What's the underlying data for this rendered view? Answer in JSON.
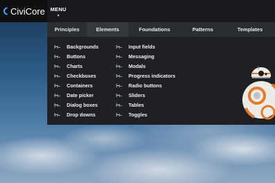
{
  "app": {
    "name": "CiviCore"
  },
  "header": {
    "menu_label": "MENU"
  },
  "tabs": [
    {
      "label": "Principles"
    },
    {
      "label": "Elements"
    },
    {
      "label": "Foundations"
    },
    {
      "label": "Patterns"
    },
    {
      "label": "Templates"
    }
  ],
  "active_tab": "Elements",
  "elements_column_1": [
    {
      "label": "Backgrounds"
    },
    {
      "label": "Buttons"
    },
    {
      "label": "Charts"
    },
    {
      "label": "Checkboxes"
    },
    {
      "label": "Containers"
    },
    {
      "label": "Date picker"
    },
    {
      "label": "Dialog boxes"
    },
    {
      "label": "Drop downs"
    }
  ],
  "elements_column_2": [
    {
      "label": "Input fields"
    },
    {
      "label": "Messaging"
    },
    {
      "label": "Modals"
    },
    {
      "label": "Progress indicators"
    },
    {
      "label": "Radio buttons"
    },
    {
      "label": "Sliders"
    },
    {
      "label": "Tables"
    },
    {
      "label": "Toggles"
    }
  ],
  "colors": {
    "topbar": "#17191d",
    "panel": "#1e2024",
    "tab_bar": "#2a2d31",
    "accent": "#4aa3ff"
  },
  "icons": {
    "logo": "civicore-logo-icon",
    "item": "element-glyph-icon",
    "menu_caret": "caret-down-icon"
  }
}
